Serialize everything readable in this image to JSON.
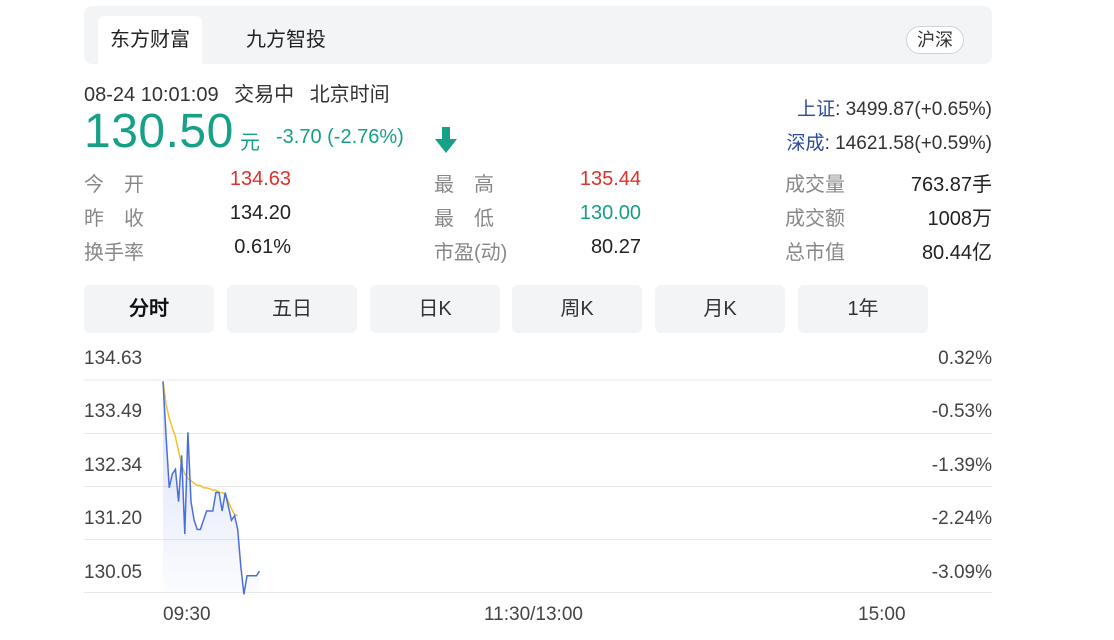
{
  "tabs": [
    {
      "label": "东方财富"
    },
    {
      "label": "九方智投"
    }
  ],
  "market_button": "沪深",
  "status": {
    "datetime": "08-24 10:01:09",
    "trade_state": "交易中",
    "timezone": "北京时间"
  },
  "quote": {
    "price": "130.50",
    "unit": "元",
    "change": "-3.70 (-2.76%)"
  },
  "indices": [
    {
      "name": "上证",
      "value": ": 3499.87(+0.65%)"
    },
    {
      "name": "深成",
      "value": ": 14621.58(+0.59%)"
    }
  ],
  "stats": {
    "open": {
      "label": "今　开",
      "value": "134.63"
    },
    "prev_close": {
      "label": "昨　收",
      "value": "134.20"
    },
    "turnover_rate": {
      "label": "换手率",
      "value": "0.61%"
    },
    "high": {
      "label": "最　高",
      "value": "135.44"
    },
    "low": {
      "label": "最　低",
      "value": "130.00"
    },
    "pe": {
      "label": "市盈(动)",
      "value": "80.27"
    },
    "volume": {
      "label": "成交量",
      "value": "763.87手"
    },
    "amount": {
      "label": "成交额",
      "value": "1008万"
    },
    "market_cap": {
      "label": "总市值",
      "value": "80.44亿"
    }
  },
  "periods": [
    {
      "label": "分时"
    },
    {
      "label": "五日"
    },
    {
      "label": "日K"
    },
    {
      "label": "周K"
    },
    {
      "label": "月K"
    },
    {
      "label": "1年"
    }
  ],
  "colors": {
    "up": "#e0302b",
    "down": "#16a086",
    "price_line": "#4a6fdc",
    "avg_line": "#f5c02c"
  },
  "chart_data": {
    "type": "line",
    "y_ticks_price": [
      "134.63",
      "133.49",
      "132.34",
      "131.20",
      "130.05"
    ],
    "y_ticks_pct": [
      "0.32%",
      "-0.53%",
      "-1.39%",
      "-2.24%",
      "-3.09%"
    ],
    "x_ticks": [
      "09:30",
      "11:30/13:00",
      "15:00"
    ],
    "ylim": [
      130.05,
      134.63
    ],
    "x_minutes_total": 240,
    "series": [
      {
        "role": "price",
        "x": [
          0,
          1,
          2,
          3,
          4,
          5,
          6,
          7,
          8,
          9,
          10,
          11,
          12,
          13,
          14,
          15,
          16,
          17,
          18,
          19,
          20,
          21,
          22,
          23,
          24,
          25,
          26,
          27,
          28,
          29,
          30,
          31
        ],
        "values": [
          134.6,
          133.4,
          132.3,
          132.6,
          132.7,
          132.0,
          133.0,
          131.3,
          133.5,
          132.0,
          131.6,
          131.4,
          131.4,
          131.6,
          131.8,
          131.8,
          131.8,
          132.2,
          132.2,
          131.8,
          132.2,
          131.9,
          131.6,
          131.7,
          131.4,
          130.6,
          130.0,
          130.4,
          130.4,
          130.4,
          130.4,
          130.5
        ]
      },
      {
        "role": "average",
        "x": [
          0,
          1,
          2,
          3,
          4,
          5,
          6,
          7,
          8,
          9,
          10,
          11,
          12,
          13,
          14,
          15,
          16,
          17,
          18,
          19,
          20,
          21,
          22,
          23,
          24
        ],
        "values": [
          134.6,
          134.1,
          133.8,
          133.6,
          133.4,
          133.1,
          132.8,
          132.6,
          132.5,
          132.45,
          132.4,
          132.35,
          132.35,
          132.3,
          132.3,
          132.28,
          132.25,
          132.25,
          132.2,
          132.2,
          132.15,
          132.0,
          131.85,
          131.72,
          131.7
        ]
      }
    ]
  }
}
